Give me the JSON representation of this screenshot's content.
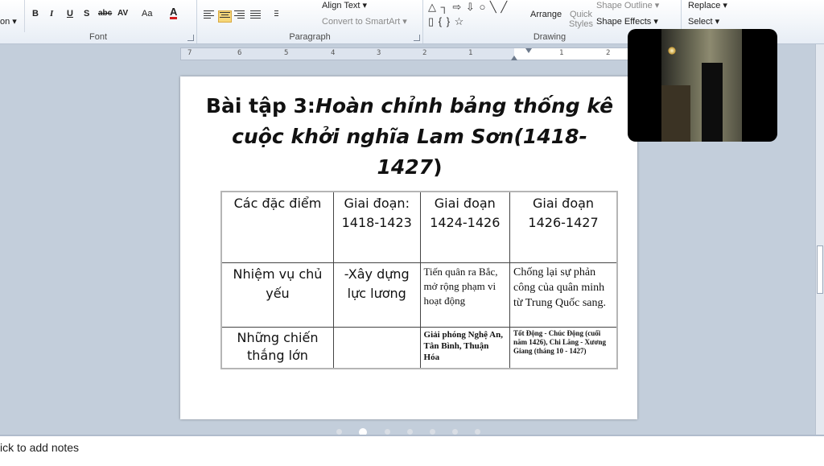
{
  "ribbon": {
    "font": {
      "label": "Font",
      "left_partial": "on ▾",
      "bold": "B",
      "italic": "I",
      "underline": "U",
      "strikethrough": "S",
      "shadow": "abc",
      "spacing": "AV",
      "case": "Aa",
      "font_color": "A"
    },
    "paragraph": {
      "label": "Paragraph",
      "align_text": "Align Text ▾",
      "convert_smartart": "Convert to SmartArt ▾"
    },
    "drawing": {
      "label": "Drawing",
      "shape_symbols": "△ ┐ ⇨ ⇩ ○ ╲ ╱ ▯ { } ☆",
      "arrange": "Arrange",
      "quick_styles": "Quick Styles",
      "shape_outline": "Shape Outline ▾",
      "shape_effects": "Shape Effects ▾"
    },
    "editing": {
      "replace": "Replace ▾",
      "select": "Select ▾"
    }
  },
  "ruler": {
    "numbers": [
      "7",
      "6",
      "5",
      "4",
      "3",
      "2",
      "1",
      "1",
      "2"
    ]
  },
  "slide": {
    "title_plain": "Bài tập 3:",
    "title_italic_1": "Hoàn chỉnh bảng thống kê",
    "title_italic_2": "cuộc khởi nghĩa Lam Sơn(1418-1427",
    "title_close": ")",
    "table": {
      "header": [
        "Các đặc điểm",
        "Giai đoạn: 1418-1423",
        "Giai đoạn 1424-1426",
        "Giai đoạn 1426-1427"
      ],
      "row1": [
        "Nhiệm vụ chủ yếu",
        "-Xây dựng lực lương",
        "Tiến quân ra Bắc, mở rộng phạm vi hoạt động",
        "Chống lại sự phản công của quân minh từ Trung Quốc sang."
      ],
      "row2": [
        "Những chiến thắng lớn",
        "",
        "Giải phóng Nghệ An, Tân Bình, Thuận Hóa",
        "Tốt Động - Chúc Động (cuối năm 1426), Chi Lăng - Xương Giang (tháng 10 - 1427)"
      ]
    }
  },
  "notes": {
    "placeholder": "ick to add notes"
  }
}
